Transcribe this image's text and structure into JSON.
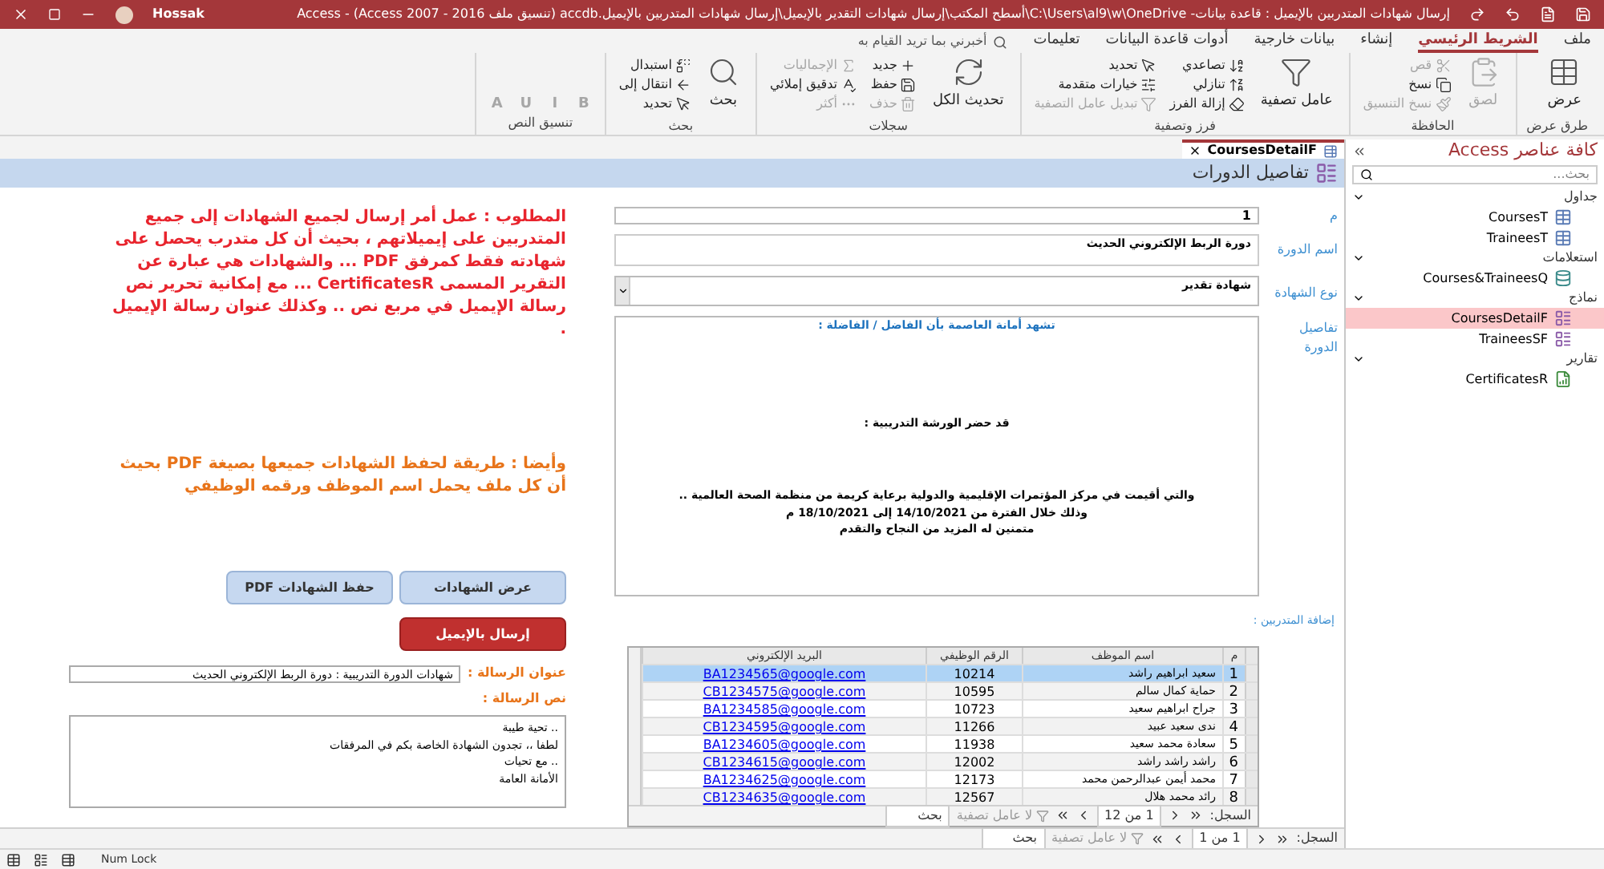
{
  "title_bar": {
    "title": "إرسال شهادات المتدربين بالإيميل : قاعدة بيانات- C:\\Users\\al9\\w\\OneDrive\\أسطح المكتب\\إرسال شهادات التقدير بالإيميل\\إرسال شهادات المتدربين بالإيميل.accdb (تنسيق ملف Access 2007 - 2016) - Access",
    "user": "Hossak"
  },
  "ribbon_tabs": [
    {
      "label": "ملف",
      "selected": false
    },
    {
      "label": "الشريط الرئيسي",
      "selected": true
    },
    {
      "label": "إنشاء",
      "selected": false
    },
    {
      "label": "بيانات خارجية",
      "selected": false
    },
    {
      "label": "أدوات قاعدة البيانات",
      "selected": false
    },
    {
      "label": "تعليمات",
      "selected": false
    }
  ],
  "tell_me": {
    "placeholder": "أخبرني بما تريد القيام به"
  },
  "ribbon_groups": [
    {
      "label": "طرق عرض",
      "buttons": [
        {
          "label": "عرض",
          "kind": "large",
          "disabled": false
        }
      ]
    },
    {
      "label": "الحافظة",
      "buttons": [
        {
          "label": "لصق",
          "kind": "large",
          "disabled": true
        },
        {
          "label": "قص",
          "kind": "small",
          "disabled": true
        },
        {
          "label": "نسخ",
          "kind": "small",
          "disabled": false
        },
        {
          "label": "نسخ التنسيق",
          "kind": "small",
          "disabled": true
        }
      ]
    },
    {
      "label": "فرز وتصفية",
      "buttons": [
        {
          "label": "عامل تصفية",
          "kind": "large",
          "disabled": false
        },
        {
          "label": "تصاعدي",
          "kind": "small",
          "disabled": false
        },
        {
          "label": "تنازلي",
          "kind": "small",
          "disabled": false
        },
        {
          "label": "إزالة الفرز",
          "kind": "small",
          "disabled": false
        },
        {
          "label": "تحديد",
          "kind": "small",
          "disabled": false
        },
        {
          "label": "خيارات متقدمة",
          "kind": "small",
          "disabled": false
        },
        {
          "label": "تبديل عامل التصفية",
          "kind": "small",
          "disabled": true
        }
      ]
    },
    {
      "label": "سجلات",
      "buttons": [
        {
          "label": "تحديث الكل",
          "kind": "large",
          "disabled": false
        },
        {
          "label": "جديد",
          "kind": "small",
          "disabled": false
        },
        {
          "label": "حفظ",
          "kind": "small",
          "disabled": false
        },
        {
          "label": "حذف",
          "kind": "small",
          "disabled": true
        },
        {
          "label": "الإجماليات",
          "kind": "small",
          "disabled": true
        },
        {
          "label": "تدقيق إملائي",
          "kind": "small",
          "disabled": false
        },
        {
          "label": "أكثر",
          "kind": "small",
          "disabled": true
        }
      ]
    },
    {
      "label": "بحث",
      "buttons": [
        {
          "label": "بحث",
          "kind": "large",
          "disabled": false
        },
        {
          "label": "استبدال",
          "kind": "small",
          "disabled": false
        },
        {
          "label": "انتقال إلى",
          "kind": "small",
          "disabled": false
        },
        {
          "label": "تحديد",
          "kind": "small",
          "disabled": false
        }
      ]
    },
    {
      "label": "تنسيق النص",
      "buttons": [
        {
          "label": "B",
          "kind": "format",
          "disabled": true
        },
        {
          "label": "I",
          "kind": "format",
          "disabled": true
        },
        {
          "label": "U",
          "kind": "format",
          "disabled": true
        },
        {
          "label": "A",
          "kind": "format",
          "disabled": true
        }
      ]
    }
  ],
  "nav_pane": {
    "title": "كافة عناصر Access",
    "search": {
      "placeholder": "بحث..."
    },
    "groups": [
      {
        "label": "جداول",
        "items": [
          {
            "label": "CoursesT",
            "kind": "table",
            "selected": false
          },
          {
            "label": "TraineesT",
            "kind": "table",
            "selected": false
          }
        ]
      },
      {
        "label": "استعلامات",
        "items": [
          {
            "label": "Courses&TraineesQ",
            "kind": "query",
            "selected": false
          }
        ]
      },
      {
        "label": "نماذج",
        "items": [
          {
            "label": "CoursesDetailF",
            "kind": "form",
            "selected": true
          },
          {
            "label": "TraineesSF",
            "kind": "form",
            "selected": false
          }
        ]
      },
      {
        "label": "تقارير",
        "items": [
          {
            "label": "CertificatesR",
            "kind": "report",
            "selected": false
          }
        ]
      }
    ]
  },
  "document_tab": {
    "label": "CoursesDetailF"
  },
  "form": {
    "header": "تفاصيل الدورات",
    "fields": [
      {
        "label": "م",
        "value": "1"
      },
      {
        "label": "اسم الدورة",
        "value": "دورة الربط الإلكتروني الحديث"
      },
      {
        "label": "نوع الشهادة",
        "value": "شهادة تقدير"
      }
    ],
    "details": {
      "label": "تفاصيل الدورة",
      "lines": [
        {
          "text": "تشهد أمانة العاصمة بأن الفاضل / الفاضلة :",
          "kind": "heading"
        },
        {
          "text": "قد حضر الورشة التدريبية :",
          "kind": "body"
        },
        {
          "text": "والتي أقيمت في مركز المؤتمرات الإقليمية والدولية برعاية كريمة من منظمة الصحة العالمية ..",
          "kind": "body"
        },
        {
          "text": "وذلك خلال الفترة من 14/10/2021 إلى 18/10/2021 م",
          "kind": "body"
        },
        {
          "text": "متمنين له المزيد من النجاح والتقدم",
          "kind": "body"
        }
      ]
    },
    "request_note": "المطلوب : عمل أمر إرسال لجميع الشهادات إلى جميع المتدربين على إيميلاتهم ، بحيث أن كل متدرب يحصل على شهادته فقط كمرفق PDF ... والشهادات هي عبارة عن التقرير المسمى CertificatesR ... مع إمكانية تحرير نص رسالة الإيميل في مربع نص .. وكذلك عنوان رسالة الإيميل .",
    "extra_note": "وأيضا : طريقة لحفظ الشهادات جميعها بصيغة PDF بحيث أن كل ملف يحمل اسم الموظف ورقمه الوظيفي",
    "buttons": [
      {
        "label": "عرض الشهادات"
      },
      {
        "label": "حفظ الشهادات PDF"
      }
    ],
    "send_button": "إرسال بالإيميل",
    "subject": {
      "label": "عنوان الرسالة :",
      "value": "شهادات الدورة التدريبية : دورة الربط الإلكتروني الحديث"
    },
    "body": {
      "label": "نص الرسالة :",
      "lines": [
        ".. تحية طيبة",
        "لطفا ،، تجدون الشهادة الخاصة بكم في المرفقات",
        ".. مع تحيات",
        "الأمانة العامة"
      ]
    },
    "trainees": {
      "label": "إضافة المتدربين :",
      "columns": [
        "م",
        "اسم الموظف",
        "الرقم الوظيفي",
        "البريد الإلكتروني"
      ],
      "rows": [
        {
          "cells": [
            "1",
            "سعيد ابراهيم راشد",
            "10214",
            "BA1234565@google.com"
          ],
          "selected": true
        },
        {
          "cells": [
            "2",
            "حماية كمال سالم",
            "10595",
            "CB1234575@google.com"
          ],
          "selected": false
        },
        {
          "cells": [
            "3",
            "جراح ابراهيم سعيد",
            "10723",
            "BA1234585@google.com"
          ],
          "selected": false
        },
        {
          "cells": [
            "4",
            "ندى سعيد عبيد",
            "11266",
            "CB1234595@google.com"
          ],
          "selected": false
        },
        {
          "cells": [
            "5",
            "سعادة محمد سعيد",
            "11938",
            "BA1234605@google.com"
          ],
          "selected": false
        },
        {
          "cells": [
            "6",
            "راشد راشد راشد",
            "12002",
            "CB1234615@google.com"
          ],
          "selected": false
        },
        {
          "cells": [
            "7",
            "محمد أيمن عبدالرحمن محمد",
            "12173",
            "BA1234625@google.com"
          ],
          "selected": false
        },
        {
          "cells": [
            "8",
            "رائد محمد هلال",
            "12567",
            "CB1234635@google.com"
          ],
          "selected": false
        }
      ],
      "record_nav": {
        "label": "السجل:",
        "position": "1 من 12",
        "filter": "لا عامل تصفية",
        "search": "بحث"
      }
    }
  },
  "record_nav": {
    "label": "السجل:",
    "position": "1 من 1",
    "filter": "لا عامل تصفية",
    "search": "بحث"
  },
  "status_bar": {
    "text": "Num Lock"
  }
}
